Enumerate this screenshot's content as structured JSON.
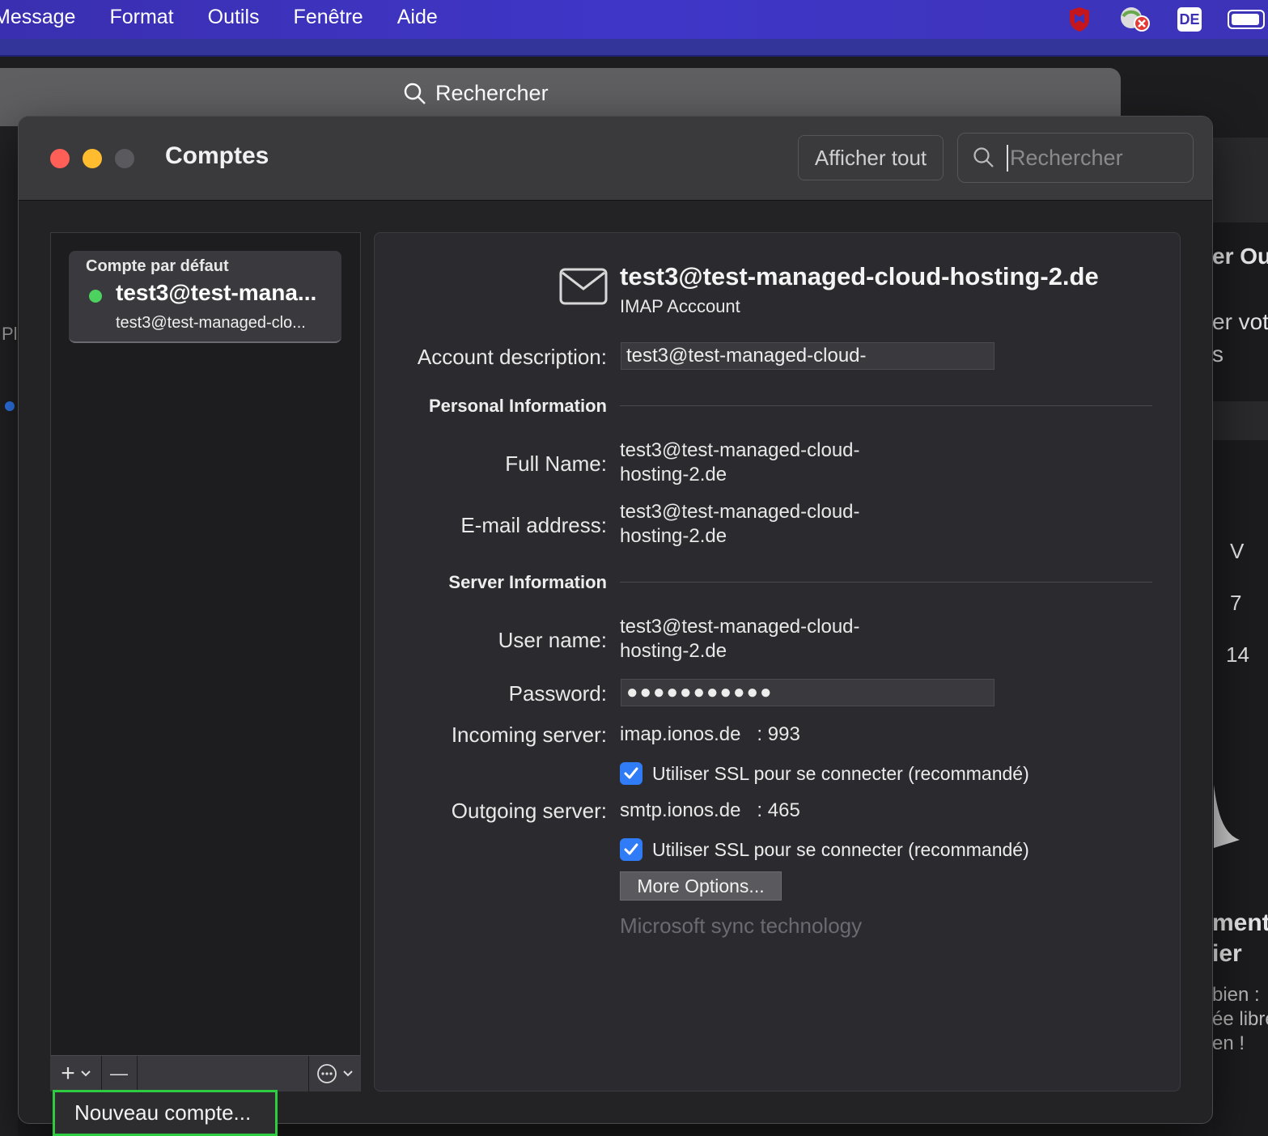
{
  "menubar": {
    "items": [
      "Message",
      "Format",
      "Outils",
      "Fenêtre",
      "Aide"
    ],
    "keyboard_badge": "DE"
  },
  "background": {
    "search_label": "Rechercher",
    "right_fragments": [
      "er Out",
      "er vot",
      "s",
      "V",
      "7",
      "14",
      "ment",
      "ier",
      "bien :",
      "ée libre",
      "en !"
    ],
    "left_fragment": "Pl"
  },
  "window": {
    "title": "Comptes",
    "show_all_label": "Afficher tout",
    "search_placeholder": "Rechercher"
  },
  "sidebar": {
    "section_header": "Compte par défaut",
    "account": {
      "name": "test3@test-mana...",
      "subtitle": "test3@test-managed-clo...",
      "status_color": "#4cd25f"
    },
    "toolbar": {
      "add_label": "+",
      "remove_label": "—"
    }
  },
  "account_detail": {
    "title": "test3@test-managed-cloud-hosting-2.de",
    "subtitle": "IMAP Acccount",
    "description_label": "Account description:",
    "description_value": "test3@test-managed-cloud-",
    "personal_section": "Personal Information",
    "full_name_label": "Full Name:",
    "full_name_line1": "test3@test-managed-cloud-",
    "full_name_line2": "hosting-2.de",
    "email_label": "E-mail address:",
    "email_line1": "test3@test-managed-cloud-",
    "email_line2": "hosting-2.de",
    "server_section": "Server Information",
    "username_label": "User name:",
    "username_line1": "test3@test-managed-cloud-",
    "username_line2": "hosting-2.de",
    "password_label": "Password:",
    "password_value": "●●●●●●●●●●●",
    "incoming_label": "Incoming server:",
    "incoming_value": "imap.ionos.de   : 993",
    "incoming_ssl": "Utiliser SSL pour se connecter (recommandé)",
    "incoming_ssl_checked": true,
    "outgoing_label": "Outgoing server:",
    "outgoing_value": "smtp.ionos.de   : 465",
    "outgoing_ssl": "Utiliser SSL pour se connecter (recommandé)",
    "outgoing_ssl_checked": true,
    "more_options": "More Options...",
    "sync_note": "Microsoft sync technology"
  },
  "popup_menu": {
    "new_account": "Nouveau compte..."
  },
  "colors": {
    "menubar": "#3c33b8",
    "accent_checkbox": "#2f7cf6",
    "highlight_border": "#2ecc40",
    "close": "#ff5f57",
    "minimize": "#febc2e",
    "zoom_disabled": "#5a5a5e"
  }
}
